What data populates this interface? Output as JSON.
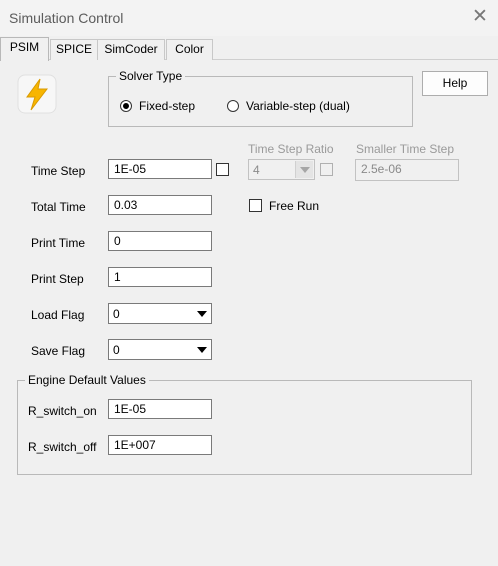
{
  "window": {
    "title": "Simulation Control"
  },
  "tabs": [
    {
      "label": "PSIM",
      "active": true
    },
    {
      "label": "SPICE",
      "active": false
    },
    {
      "label": "SimCoder",
      "active": false
    },
    {
      "label": "Color",
      "active": false
    }
  ],
  "solver": {
    "group_label": "Solver Type",
    "options": [
      {
        "label": "Fixed-step",
        "selected": true
      },
      {
        "label": "Variable-step (dual)",
        "selected": false
      }
    ]
  },
  "help_button": "Help",
  "app_icon": "lightning-bolt-icon",
  "fields": {
    "time_step": {
      "label": "Time Step",
      "value": "1E-05"
    },
    "total_time": {
      "label": "Total Time",
      "value": "0.03"
    },
    "print_time": {
      "label": "Print Time",
      "value": "0"
    },
    "print_step": {
      "label": "Print Step",
      "value": "1"
    },
    "load_flag": {
      "label": "Load Flag",
      "value": "0"
    },
    "save_flag": {
      "label": "Save Flag",
      "value": "0"
    }
  },
  "time_step_ratio": {
    "label": "Time Step Ratio",
    "value": "4"
  },
  "smaller_time_step": {
    "label": "Smaller Time Step",
    "value": "2.5e-06"
  },
  "free_run": {
    "label": "Free Run",
    "checked": false
  },
  "engine": {
    "group_label": "Engine Default Values",
    "r_switch_on": {
      "label": "R_switch_on",
      "value": "1E-05"
    },
    "r_switch_off": {
      "label": "R_switch_off",
      "value": "1E+007"
    }
  },
  "colors": {
    "accent_icon": "#f7b500",
    "window_bg": "#f0f0f0"
  }
}
